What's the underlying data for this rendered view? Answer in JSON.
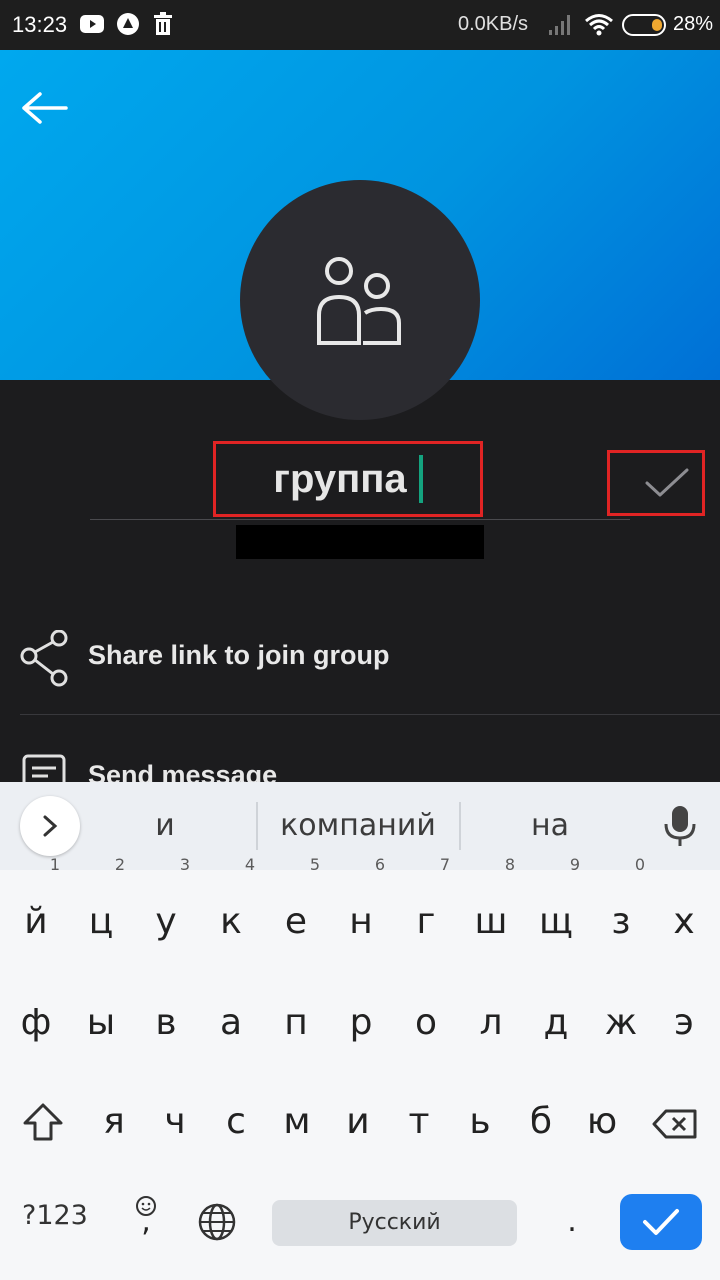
{
  "status_bar": {
    "time": "13:23",
    "net_speed": "0.0KB/s",
    "battery_percent": "28%",
    "icons": [
      "youtube-icon",
      "notification-icon",
      "trash-icon",
      "signal-icon",
      "wifi-icon",
      "battery-icon"
    ]
  },
  "group": {
    "name_value": "группа"
  },
  "actions": {
    "share_label": "Share link to join group",
    "send_label": "Send message"
  },
  "keyboard": {
    "suggestions": [
      "и",
      "компаний",
      "на"
    ],
    "row1": [
      {
        "k": "й",
        "h": "1"
      },
      {
        "k": "ц",
        "h": "2"
      },
      {
        "k": "у",
        "h": "3"
      },
      {
        "k": "к",
        "h": "4"
      },
      {
        "k": "е",
        "h": "5"
      },
      {
        "k": "н",
        "h": "6"
      },
      {
        "k": "г",
        "h": "7"
      },
      {
        "k": "ш",
        "h": "8"
      },
      {
        "k": "щ",
        "h": "9"
      },
      {
        "k": "з",
        "h": "0"
      },
      {
        "k": "х",
        "h": ""
      }
    ],
    "row2": [
      "ф",
      "ы",
      "в",
      "а",
      "п",
      "р",
      "о",
      "л",
      "д",
      "ж",
      "э"
    ],
    "row3": [
      "я",
      "ч",
      "с",
      "м",
      "и",
      "т",
      "ь",
      "б",
      "ю"
    ],
    "symbols_label": "?123",
    "comma": ",",
    "space_label": "Русский",
    "period": "."
  },
  "colors": {
    "header_gradient_start": "#00a8ee",
    "header_gradient_end": "#0070d6",
    "highlight_border": "#e02424",
    "cursor": "#14a37f",
    "done_key": "#1e7ff0"
  }
}
